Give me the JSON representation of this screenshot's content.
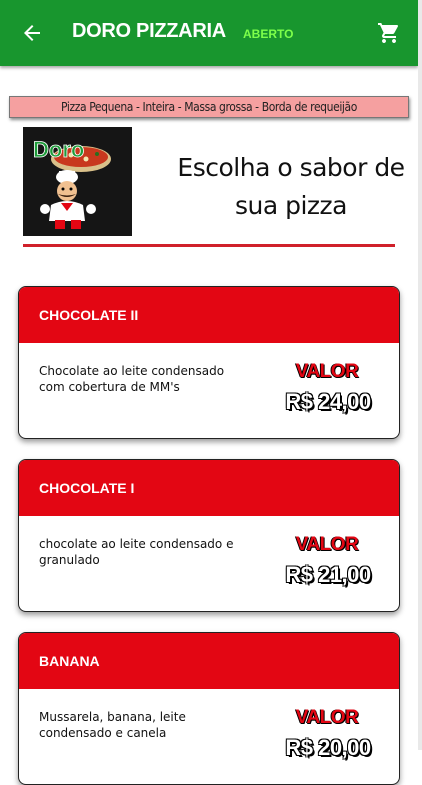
{
  "header": {
    "title": "DORO PIZZARIA",
    "status": "ABERTO",
    "back_icon": "arrow-left-icon",
    "cart_icon": "shopping-cart-icon",
    "background_color": "#18962e",
    "status_color": "#7dff4a"
  },
  "product_banner": {
    "text": "Pizza Pequena - Inteira - Massa grossa - Borda de requeijão"
  },
  "intro": {
    "logo_text": "Doro",
    "headline_line1": "Escolha o sabor de",
    "headline_line2": "sua pizza"
  },
  "accent_color": "#e30613",
  "flavors": [
    {
      "name": "CHOCOLATE II",
      "description": "Chocolate ao leite condensado com cobertura de MM's",
      "price_label": "VALOR",
      "price": "R$ 24,00"
    },
    {
      "name": "CHOCOLATE I",
      "description": "chocolate ao leite condensado e granulado",
      "price_label": "VALOR",
      "price": "R$ 21,00"
    },
    {
      "name": "BANANA",
      "description": "Mussarela, banana, leite condensado e canela",
      "price_label": "VALOR",
      "price": "R$ 20,00"
    }
  ]
}
